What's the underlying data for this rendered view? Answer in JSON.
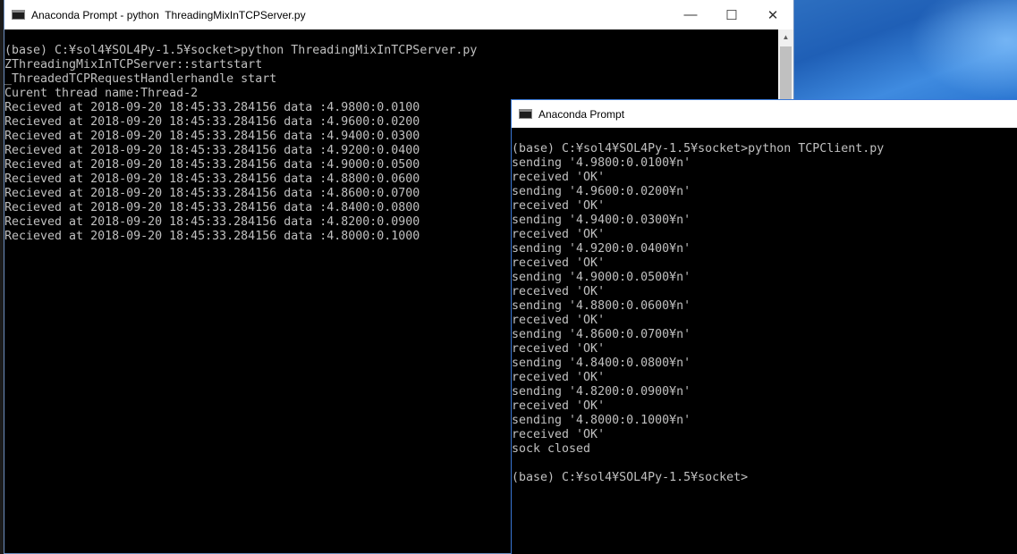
{
  "server_window": {
    "title": "Anaconda Prompt - python  ThreadingMixInTCPServer.py",
    "controls": {
      "minimize": "—",
      "maximize": "☐",
      "close": "✕"
    },
    "lines": [
      "(base) C:¥sol4¥SOL4Py-1.5¥socket>python ThreadingMixInTCPServer.py",
      "ZThreadingMixInTCPServer::startstart",
      "_ThreadedTCPRequestHandlerhandle start",
      "Curent thread name:Thread-2",
      "Recieved at 2018-09-20 18:45:33.284156 data :4.9800:0.0100",
      "Recieved at 2018-09-20 18:45:33.284156 data :4.9600:0.0200",
      "Recieved at 2018-09-20 18:45:33.284156 data :4.9400:0.0300",
      "Recieved at 2018-09-20 18:45:33.284156 data :4.9200:0.0400",
      "Recieved at 2018-09-20 18:45:33.284156 data :4.9000:0.0500",
      "Recieved at 2018-09-20 18:45:33.284156 data :4.8800:0.0600",
      "Recieved at 2018-09-20 18:45:33.284156 data :4.8600:0.0700",
      "Recieved at 2018-09-20 18:45:33.284156 data :4.8400:0.0800",
      "Recieved at 2018-09-20 18:45:33.284156 data :4.8200:0.0900",
      "Recieved at 2018-09-20 18:45:33.284156 data :4.8000:0.1000"
    ]
  },
  "client_window": {
    "title": "Anaconda Prompt",
    "lines": [
      "(base) C:¥sol4¥SOL4Py-1.5¥socket>python TCPClient.py",
      "sending '4.9800:0.0100¥n'",
      "received 'OK'",
      "sending '4.9600:0.0200¥n'",
      "received 'OK'",
      "sending '4.9400:0.0300¥n'",
      "received 'OK'",
      "sending '4.9200:0.0400¥n'",
      "received 'OK'",
      "sending '4.9000:0.0500¥n'",
      "received 'OK'",
      "sending '4.8800:0.0600¥n'",
      "received 'OK'",
      "sending '4.8600:0.0700¥n'",
      "received 'OK'",
      "sending '4.8400:0.0800¥n'",
      "received 'OK'",
      "sending '4.8200:0.0900¥n'",
      "received 'OK'",
      "sending '4.8000:0.1000¥n'",
      "received 'OK'",
      "sock closed",
      "",
      "(base) C:¥sol4¥SOL4Py-1.5¥socket>"
    ]
  },
  "scrollbar": {
    "up_arrow": "▲"
  }
}
